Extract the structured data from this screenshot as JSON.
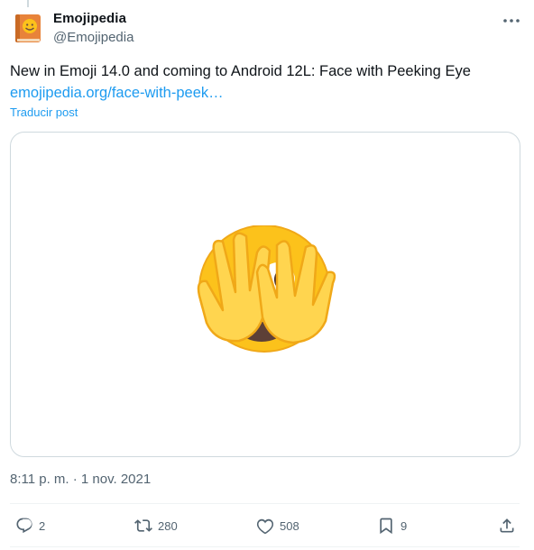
{
  "author": {
    "display_name": "Emojipedia",
    "handle": "@Emojipedia"
  },
  "tweet": {
    "text": "New in Emoji 14.0 and coming to Android 12L: Face with Peeking Eye",
    "link_text": "emojipedia.org/face-with-peek…",
    "translate_label": "Traducir post",
    "media_description": "face-with-peeking-eye emoji",
    "timestamp": "8:11 p. m. · 1 nov. 2021"
  },
  "actions": {
    "replies": "2",
    "reposts": "280",
    "likes": "508",
    "bookmarks": "9"
  },
  "colors": {
    "link": "#1d9bf0",
    "secondary_text": "#536471",
    "emoji_yellow": "#fcc21b",
    "hand_yellow": "#ffd54f"
  },
  "icons": {
    "more": "more-horizontal-icon",
    "reply": "reply-icon",
    "repost": "repost-icon",
    "like": "heart-icon",
    "bookmark": "bookmark-icon",
    "share": "share-icon"
  }
}
